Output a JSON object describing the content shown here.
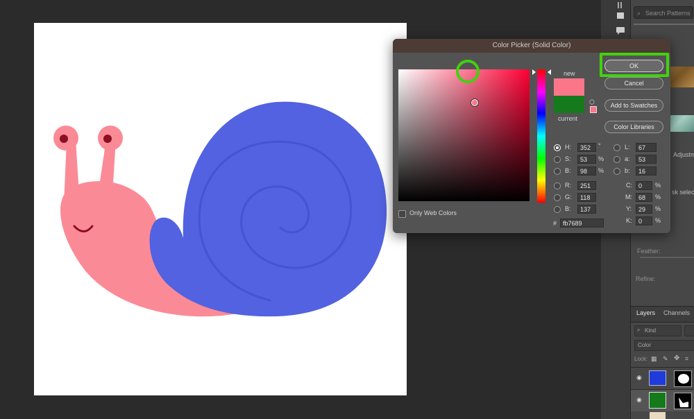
{
  "right_panel": {
    "search_placeholder": "Search Patterns",
    "adjust_label": "Adjustm",
    "mask_label": "sk selecte",
    "feather_label": "Feather:",
    "refine_label": "Refine:",
    "tabs": [
      "Layers",
      "Channels"
    ],
    "kind_label": "Kind",
    "color_filter_label": "Color",
    "lock_label": "Lock:",
    "layer_colors": [
      "#1f3bdb",
      "#157a1b"
    ]
  },
  "dialog": {
    "title": "Color Picker (Solid Color)",
    "new_label": "new",
    "current_label": "current",
    "new_color": "#fb7689",
    "current_color": "#157a1b",
    "only_web_colors": "Only Web Colors",
    "buttons": {
      "ok": "OK",
      "cancel": "Cancel",
      "add_swatches": "Add to Swatches",
      "color_libraries": "Color Libraries"
    },
    "hsb": {
      "h_label": "H:",
      "h": "352",
      "h_unit": "°",
      "s_label": "S:",
      "s": "53",
      "s_unit": "%",
      "b_label": "B:",
      "b": "98",
      "b_unit": "%"
    },
    "rgb": {
      "r_label": "R:",
      "r": "251",
      "g_label": "G:",
      "g": "118",
      "b_label": "B:",
      "b": "137"
    },
    "lab": {
      "l_label": "L:",
      "l": "67",
      "a_label": "a:",
      "a": "53",
      "b_label": "b:",
      "b": "16"
    },
    "cmyk": {
      "c_label": "C:",
      "c": "0",
      "m_label": "M:",
      "m": "68",
      "y_label": "Y:",
      "y": "29",
      "k_label": "K:",
      "k": "0",
      "unit": "%"
    },
    "hex_label": "#",
    "hex": "fb7689"
  },
  "canvas": {
    "snail_body_color": "#fb8a97",
    "snail_shell_color": "#5262e0",
    "spiral_color": "#4355d2"
  }
}
